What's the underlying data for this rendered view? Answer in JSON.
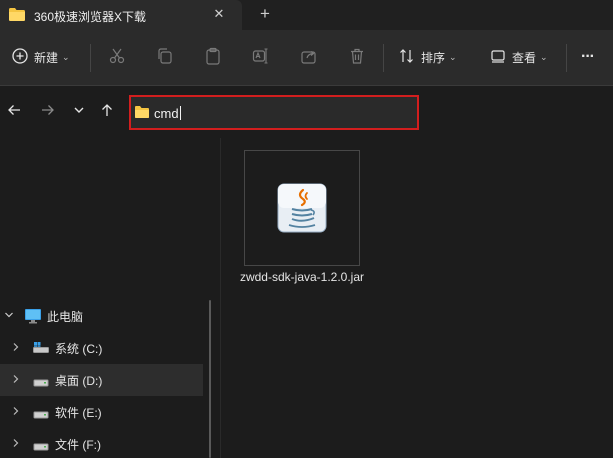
{
  "window": {
    "tab_title": "360极速浏览器X下载",
    "tab_close_icon": "close-icon",
    "new_tab_icon": "plus-icon"
  },
  "toolbar": {
    "new_label": "新建",
    "sort_label": "排序",
    "view_label": "查看",
    "more_label": "···"
  },
  "address": {
    "path": "cmd"
  },
  "sidebar": {
    "items": [
      {
        "label": "此电脑",
        "icon": "monitor-icon",
        "expanded": true
      },
      {
        "label": "系统 (C:)",
        "icon": "system-drive-icon"
      },
      {
        "label": "桌面 (D:)",
        "icon": "drive-icon",
        "selected": true
      },
      {
        "label": "软件 (E:)",
        "icon": "drive-icon"
      },
      {
        "label": "文件 (F:)",
        "icon": "drive-icon"
      }
    ]
  },
  "content": {
    "files": [
      {
        "name": "zwdd-sdk-java-1.2.0.jar",
        "icon": "java-jar-icon"
      }
    ]
  },
  "colors": {
    "accent": "#d21e1e",
    "folder": "#f5c542",
    "background": "#1c1c1c",
    "toolbar": "#2b2b2b"
  }
}
